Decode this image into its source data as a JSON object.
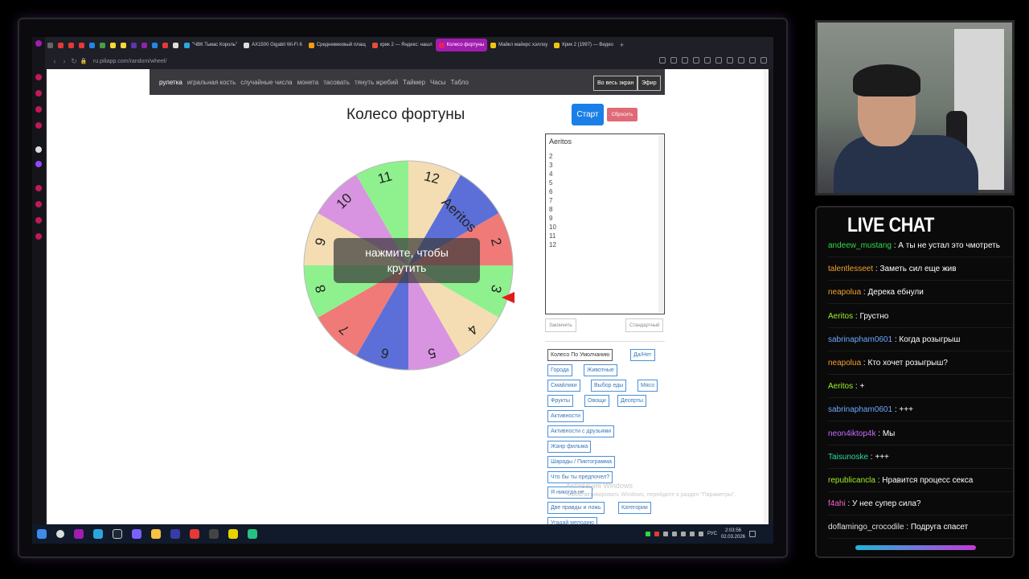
{
  "browser": {
    "tabs": [
      {
        "label": "\"ЧВК Тьмас Король\"",
        "color": "#2aa6e0",
        "active": false
      },
      {
        "label": "AX1500 Gigabit Wi-Fi 6",
        "color": "#2aa6e0",
        "active": false
      },
      {
        "label": "Средневековый плащ",
        "color": "#f39c12",
        "active": false
      },
      {
        "label": "крик 2 — Яндекс: нашл",
        "color": "#e74c3c",
        "active": false
      },
      {
        "label": "Колесо фортуны",
        "color": "#e91e63",
        "active": true
      },
      {
        "label": "Майкл майерс хэллоу",
        "color": "#f1c40f",
        "active": false
      },
      {
        "label": "Крик 2 (1997) — Видео",
        "color": "#f1c40f",
        "active": false
      }
    ],
    "url": "ru.piliapp.com/random/wheel/"
  },
  "site_nav": {
    "links": [
      "рулетка",
      "игральная кость",
      "случайные числа",
      "монета",
      "тасовать",
      "тянуть жребий",
      "Таймер",
      "Часы",
      "Табло"
    ],
    "fullscreen_label": "Во весь экран",
    "broadcast_label": "Эфир"
  },
  "wheel": {
    "title": "Колесо фортуны",
    "overlay_line1": "нажмите, чтобы",
    "overlay_line2": "крутить",
    "segments": [
      {
        "label": "Aeritos",
        "color": "#5c6fd8"
      },
      {
        "label": "2",
        "color": "#f07a78"
      },
      {
        "label": "3",
        "color": "#8ef18e"
      },
      {
        "label": "4",
        "color": "#f4ddb3"
      },
      {
        "label": "5",
        "color": "#d894e0"
      },
      {
        "label": "6",
        "color": "#5c6fd8"
      },
      {
        "label": "7",
        "color": "#f07a78"
      },
      {
        "label": "8",
        "color": "#8ef18e"
      },
      {
        "label": "9",
        "color": "#f4ddb3"
      },
      {
        "label": "10",
        "color": "#d894e0"
      },
      {
        "label": "11",
        "color": "#8ef18e"
      },
      {
        "label": "12",
        "color": "#f4ddb3"
      }
    ],
    "pointer_color": "#e01b1b"
  },
  "controls": {
    "start_label": "Старт",
    "reset_label": "Сбросить",
    "finish_label": "Закончить",
    "standard_label": "Стандартный"
  },
  "entries": {
    "first": "Aeritos",
    "lines": [
      "2",
      "3",
      "4",
      "5",
      "6",
      "7",
      "8",
      "9",
      "10",
      "11",
      "12"
    ]
  },
  "presets": [
    "Колесо По Умолчанию",
    "Да/Нет",
    "Города",
    "Животные",
    "Смайлики",
    "Выбор еды",
    "Мясо",
    "Фрукты",
    "Овощи",
    "Десерты",
    "Активности",
    "Активности с друзьями",
    "Жанр фильма",
    "Шарады / Пиктограмма",
    "Что бы ты предпочел?",
    "Я никогда не...",
    "Две правды и ложь",
    "Категории",
    "Угадай мелодию"
  ],
  "watermark": {
    "title": "Активация Windows",
    "subtitle": "Чтобы активировать Windows, перейдите в раздел \"Параметры\"."
  },
  "taskbar": {
    "lang": "РУС",
    "time": "2:03:56",
    "date": "02.03.2026"
  },
  "chat": {
    "title": "LIVE CHAT",
    "messages": [
      {
        "user": "andeew_mustang",
        "text": "А ты не устал это чмотреть",
        "color": "#2ed94a"
      },
      {
        "user": "talentlesseet",
        "text": "Заметь сил еще жив",
        "color": "#f0a030"
      },
      {
        "user": "neapolua",
        "text": "Дерека ебнули",
        "color": "#f0a030"
      },
      {
        "user": "Aeritos",
        "text": "Грустно",
        "color": "#9cf02a"
      },
      {
        "user": "sabrinapham0601",
        "text": "Когда розыгрыш",
        "color": "#6aa8ff"
      },
      {
        "user": "neapolua",
        "text": "Кто хочет розыгрыш?",
        "color": "#f0a030"
      },
      {
        "user": "Aeritos",
        "text": "+",
        "color": "#9cf02a"
      },
      {
        "user": "sabrinapham0601",
        "text": "+++",
        "color": "#6aa8ff"
      },
      {
        "user": "neon4iktop4k",
        "text": "Мы",
        "color": "#c86bff"
      },
      {
        "user": "Taisunoske",
        "text": "+++",
        "color": "#2ed9a0"
      },
      {
        "user": "republicancla",
        "text": "Нравится процесс секса",
        "color": "#9cf02a"
      },
      {
        "user": "f4ahi",
        "text": "У нее супер сила?",
        "color": "#ff5fc8"
      },
      {
        "user": "doflamingo_crocodile",
        "text": "Подруга спасет",
        "color": "#e0e0e0"
      }
    ]
  }
}
